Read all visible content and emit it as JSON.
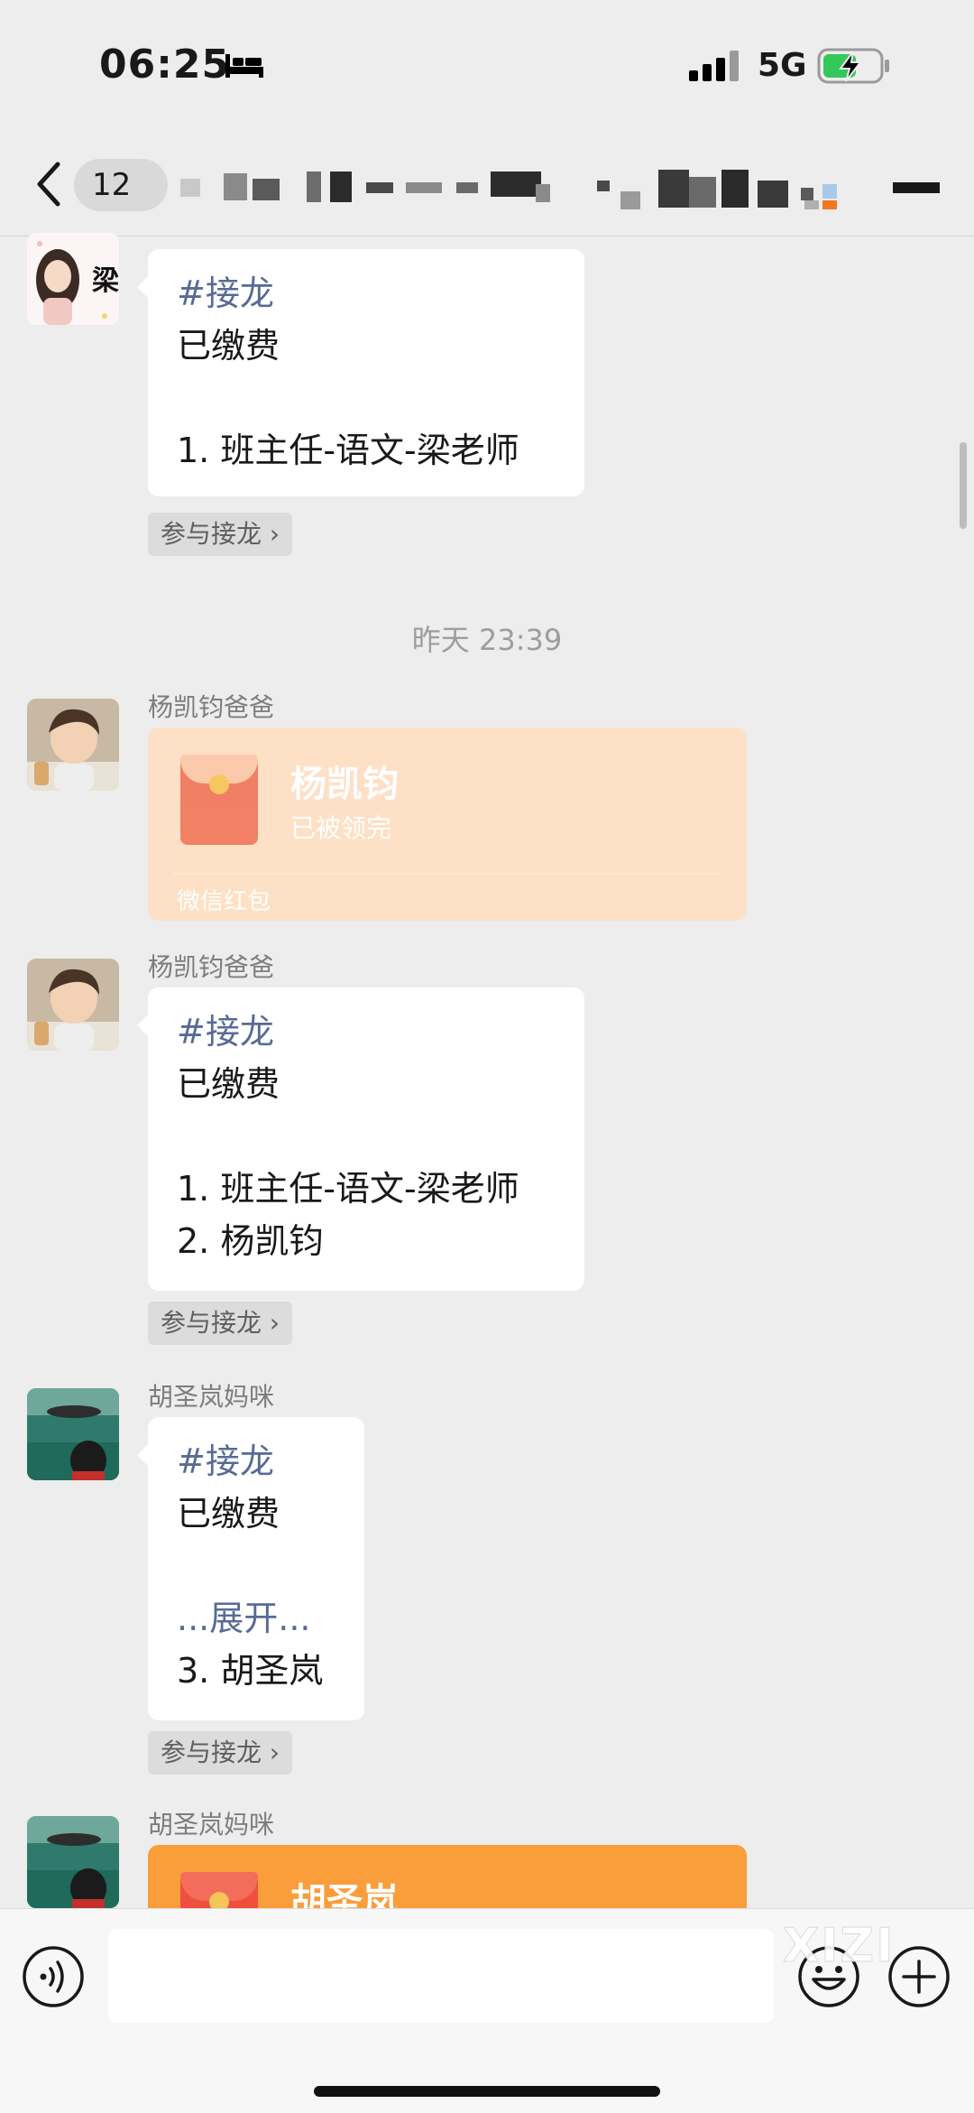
{
  "status_bar": {
    "time": "06:25",
    "network": "5G"
  },
  "nav": {
    "unread_count": "12"
  },
  "messages": [
    {
      "id": "m1",
      "type": "solitaire",
      "tag": "#接龙",
      "lines": [
        "已缴费",
        "",
        "1. 班主任-语文-梁老师"
      ],
      "join_label": "参与接龙"
    },
    {
      "id": "ts",
      "type": "timestamp",
      "text": "昨天 23:39"
    },
    {
      "id": "m2",
      "type": "redpacket",
      "sender": "杨凯钧爸爸",
      "name": "杨凯钧",
      "status": "已被领完",
      "label": "微信红包"
    },
    {
      "id": "m3",
      "type": "solitaire",
      "sender": "杨凯钧爸爸",
      "tag": "#接龙",
      "lines": [
        "已缴费",
        "",
        "1. 班主任-语文-梁老师",
        "2. 杨凯钧"
      ],
      "join_label": "参与接龙"
    },
    {
      "id": "m4",
      "type": "solitaire",
      "sender": "胡圣岚妈咪",
      "tag": "#接龙",
      "lines": [
        "已缴费",
        "",
        "...展开...",
        "3. 胡圣岚"
      ],
      "join_label": "参与接龙"
    },
    {
      "id": "m5",
      "type": "redpacket",
      "sender": "胡圣岚妈咪",
      "name": "胡圣岚"
    }
  ],
  "avatar_text": {
    "teacher": "梁"
  },
  "watermark": "XIZI",
  "colors": {
    "background": "#ededed",
    "bubble": "#ffffff",
    "link_blue": "#576b95",
    "redpacket_faded": "#fde0c5",
    "redpacket_active": "#fa9d3b"
  }
}
